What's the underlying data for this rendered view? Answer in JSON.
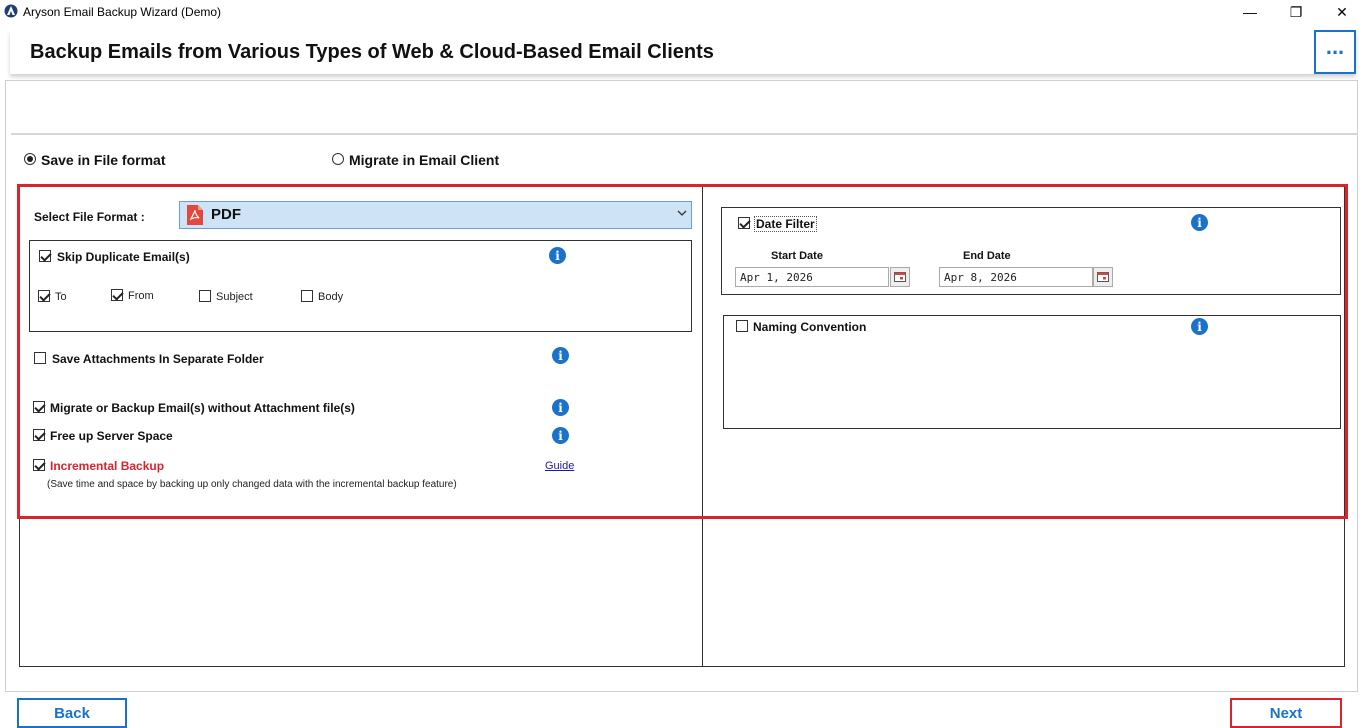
{
  "window": {
    "title": "Aryson Email Backup Wizard (Demo)",
    "minimize": "—",
    "maximize": "❐",
    "close": "✕"
  },
  "header": {
    "title": "Backup Emails from Various Types of Web & Cloud-Based Email Clients",
    "more_label": "..."
  },
  "mode": {
    "save_file": "Save in File format",
    "migrate_client": "Migrate in Email Client",
    "selected": "save_file"
  },
  "left": {
    "select_label": "Select File Format :",
    "format_value": "PDF",
    "skip_duplicate": {
      "label": "Skip Duplicate Email(s)",
      "checked": true
    },
    "skip_options": [
      {
        "label": "To",
        "checked": true
      },
      {
        "label": "From",
        "checked": true
      },
      {
        "label": "Subject",
        "checked": false
      },
      {
        "label": "Body",
        "checked": false
      }
    ],
    "save_attachments": {
      "label": "Save Attachments In Separate Folder",
      "checked": false
    },
    "without_attachment": {
      "label": "Migrate or Backup Email(s) without Attachment file(s)",
      "checked": true
    },
    "free_space": {
      "label": "Free up Server Space",
      "checked": true
    },
    "incremental": {
      "label": "Incremental Backup",
      "checked": true,
      "color": "#d9232e"
    },
    "guide": "Guide",
    "incremental_note": "(Save time and space by backing up only changed data with the incremental backup feature)"
  },
  "right": {
    "date_filter": {
      "label": "Date Filter",
      "checked": true
    },
    "start_label": "Start Date",
    "end_label": "End Date",
    "start_value": "Apr 1, 2026",
    "end_value": "Apr 8, 2026",
    "naming": {
      "label": "Naming Convention",
      "checked": false
    }
  },
  "footer": {
    "back": "Back",
    "next": "Next"
  },
  "icons": {
    "info": "i",
    "app": "aryson-logo-icon",
    "pdf": "pdf-file-icon",
    "calendar": "calendar-icon",
    "chevron": "chevron-down-icon"
  },
  "colors": {
    "accent": "#1a72c9",
    "highlight": "#d9232e",
    "select_bg": "#cfe3f7"
  }
}
